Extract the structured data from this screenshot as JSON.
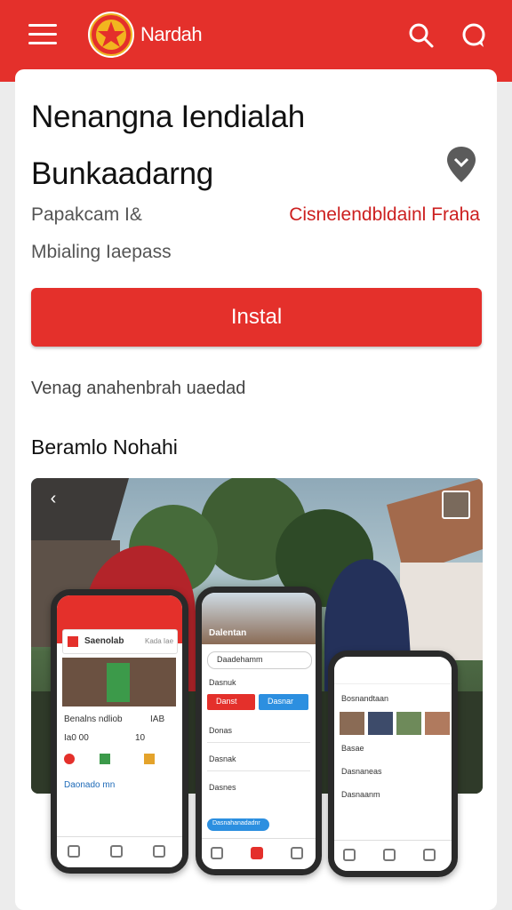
{
  "appbar": {
    "brand_name": "Nardah",
    "accent_color": "#e4302b",
    "icons": [
      "menu-icon",
      "logo-emblem",
      "search-icon",
      "chat-icon"
    ]
  },
  "detail": {
    "title_line1": "Nenangna Iendialah",
    "title_line2": "Bunkaadarng",
    "meta_left_line1": "Papakcam I&",
    "meta_left_line2": "Mbialing Iaepass",
    "meta_right": "Cisnelendbldainl Fraha",
    "install_label": "Instal",
    "subtext": "Venag anahenbrah uaedad",
    "section_title": "Beramlo Nohahi"
  },
  "phone_left": {
    "header_label": "Saenolab",
    "header_pill": "Kada Iae",
    "rows": [
      "Benalns ndliob",
      "Ia0 00",
      "Daonado mn"
    ],
    "stat_value": "IAB",
    "stat_value2": "10"
  },
  "phone_middle": {
    "header_label": "Dalentan",
    "search_text": "Daadehamm",
    "rows": [
      "Dasnuk",
      "Donas",
      "Dasnak",
      "Dasnes"
    ],
    "btn_red": "Danst",
    "btn_blue": "Dasnar",
    "pill": "Dasnahanadadnr"
  },
  "phone_right": {
    "header_label": "Bosnandtaan",
    "rows": [
      "Basae",
      "Dasnaneas",
      "Dasnaanm"
    ]
  }
}
